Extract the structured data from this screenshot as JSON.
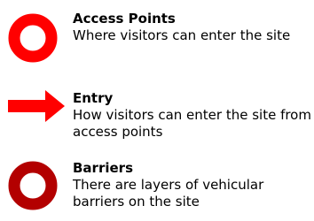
{
  "legend": {
    "items": [
      {
        "title": "Access Points",
        "description": "Where visitors can enter the site",
        "symbol": "red-ring-icon",
        "color": "#ff0000"
      },
      {
        "title": "Entry",
        "description": "How visitors can enter the site from access points",
        "symbol": "red-arrow-icon",
        "color": "#ff0000"
      },
      {
        "title": "Barriers",
        "description": "There are layers of vehicular barriers on the site",
        "symbol": "dark-red-ring-icon",
        "color": "#b30000"
      }
    ]
  }
}
